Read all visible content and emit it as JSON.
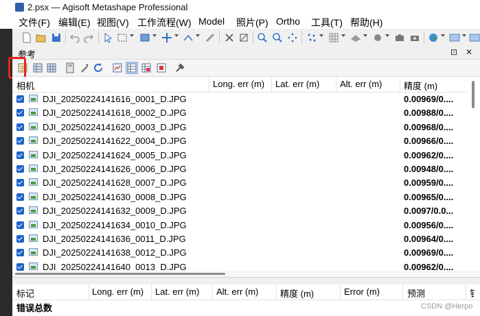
{
  "window": {
    "title": "2.psx — Agisoft Metashape Professional"
  },
  "menubar": {
    "items": [
      "文件(F)",
      "编辑(E)",
      "视图(V)",
      "工作流程(W)",
      "Model",
      "照片(P)",
      "Ortho",
      "工具(T)",
      "帮助(H)"
    ]
  },
  "panel": {
    "title": "参考",
    "float_btn": "⊡",
    "close_btn": "✕"
  },
  "cameras_table": {
    "columns": [
      "相机",
      "Long. err (m)",
      "Lat. err (m)",
      "Alt. err (m)",
      "精度 (m)"
    ],
    "rows": [
      {
        "name": "DJI_20250224141616_0001_D.JPG",
        "accuracy": "0.00969/0...."
      },
      {
        "name": "DJI_20250224141618_0002_D.JPG",
        "accuracy": "0.00988/0...."
      },
      {
        "name": "DJI_20250224141620_0003_D.JPG",
        "accuracy": "0.00968/0...."
      },
      {
        "name": "DJI_20250224141622_0004_D.JPG",
        "accuracy": "0.00966/0...."
      },
      {
        "name": "DJI_20250224141624_0005_D.JPG",
        "accuracy": "0.00962/0...."
      },
      {
        "name": "DJI_20250224141626_0006_D.JPG",
        "accuracy": "0.00948/0...."
      },
      {
        "name": "DJI_20250224141628_0007_D.JPG",
        "accuracy": "0.00959/0...."
      },
      {
        "name": "DJI_20250224141630_0008_D.JPG",
        "accuracy": "0.00965/0...."
      },
      {
        "name": "DJI_20250224141632_0009_D.JPG",
        "accuracy": "0.0097/0.0..."
      },
      {
        "name": "DJI_20250224141634_0010_D.JPG",
        "accuracy": "0.00956/0...."
      },
      {
        "name": "DJI_20250224141636_0011_D.JPG",
        "accuracy": "0.00964/0...."
      },
      {
        "name": "DJI_20250224141638_0012_D.JPG",
        "accuracy": "0.00969/0...."
      },
      {
        "name": "DJI_20250224141640_0013_D.JPG",
        "accuracy": "0.00962/0...."
      }
    ]
  },
  "markers_table": {
    "columns": [
      "标记",
      "Long. err (m)",
      "Lat. err (m)",
      "Alt. err (m)",
      "精度 (m)",
      "Error (m)",
      "预测",
      "钅"
    ],
    "total_label": "错误总数"
  },
  "watermark": "CSDN @Herpo",
  "icons": {
    "toolbar": [
      "new-icon",
      "open-icon",
      "save-icon",
      "undo-icon",
      "redo-icon",
      "select-icon",
      "rect-select-icon",
      "navigate-icon",
      "move-icon",
      "rotate-icon",
      "ruler-icon",
      "delete-icon",
      "crop-icon",
      "zoom-in-icon",
      "zoom-out-icon",
      "pan-icon",
      "points-icon",
      "grid-icon",
      "shading-icon",
      "texture-icon",
      "camera-icon",
      "globe-icon",
      "view-icon"
    ],
    "panel_toolbar": [
      "import-reference-icon",
      "export-reference-icon",
      "convert-icon",
      "calculator-icon",
      "optimize-icon",
      "update-icon",
      "view-source-icon",
      "view-estimated-icon",
      "view-errors-icon",
      "reset-transform-icon",
      "settings-icon"
    ]
  },
  "colors": {
    "highlight": "#e8231c",
    "checkbox": "#1d63c9"
  }
}
